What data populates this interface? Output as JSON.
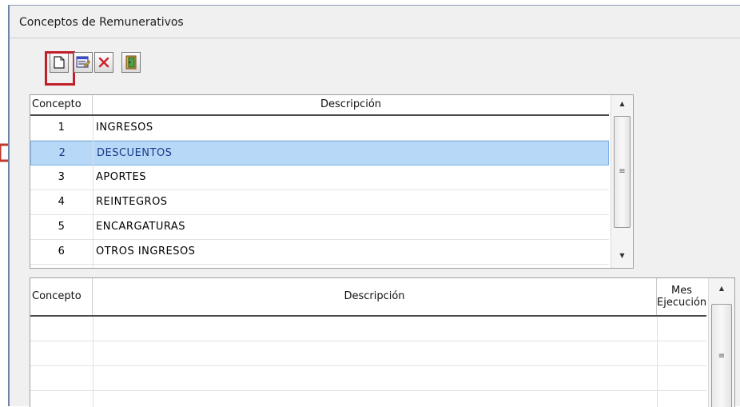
{
  "window": {
    "title": "Conceptos de Remunerativos"
  },
  "toolbar": {
    "buttons": [
      {
        "name": "new-button",
        "icon": "new-document-icon"
      },
      {
        "name": "edit-button",
        "icon": "edit-form-icon"
      },
      {
        "name": "delete-button",
        "icon": "delete-x-icon"
      },
      {
        "name": "exit-button",
        "icon": "exit-door-icon"
      }
    ],
    "highlight_color": "#c0202a"
  },
  "top_grid": {
    "headers": {
      "concepto": "Concepto",
      "descripcion": "Descripción"
    },
    "rows": [
      {
        "concepto": "1",
        "descripcion": "INGRESOS"
      },
      {
        "concepto": "2",
        "descripcion": "DESCUENTOS"
      },
      {
        "concepto": "3",
        "descripcion": "APORTES"
      },
      {
        "concepto": "4",
        "descripcion": "REINTEGROS"
      },
      {
        "concepto": "5",
        "descripcion": "ENCARGATURAS"
      },
      {
        "concepto": "6",
        "descripcion": "OTROS INGRESOS"
      }
    ],
    "selected_row": 1,
    "selected_color": "#b7d8f7"
  },
  "bottom_grid": {
    "headers": {
      "concepto": "Concepto",
      "descripcion": "Descripción",
      "mes_line1": "Mes",
      "mes_line2": "Ejecución"
    }
  },
  "pointer_arrow_color": "#c0392b"
}
